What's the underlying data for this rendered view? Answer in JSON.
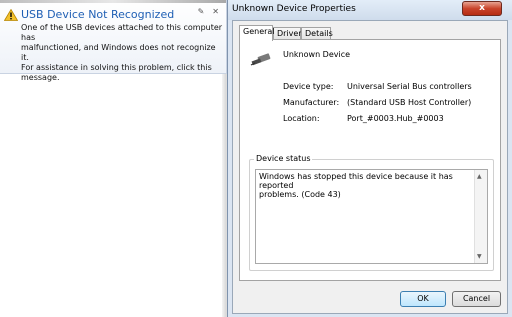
{
  "notification": {
    "title": "USB Device Not Recognized",
    "message_lines": [
      "One of the USB devices attached to this computer has",
      "malfunctioned, and Windows does not recognize it.",
      "For assistance in solving this problem, click this",
      "message."
    ],
    "warning_icon": "warning-triangle-icon",
    "pin_icon": "pin-icon",
    "close_icon": "close-icon"
  },
  "dialog": {
    "title": "Unknown Device Properties",
    "close_label": "x",
    "tabs": [
      "General",
      "Driver",
      "Details"
    ],
    "active_tab": "General",
    "device_name": "Unknown Device",
    "device_icon": "usb-plug-icon",
    "properties": [
      {
        "label": "Device type:",
        "value": "Universal Serial Bus controllers"
      },
      {
        "label": "Manufacturer:",
        "value": "(Standard USB Host Controller)"
      },
      {
        "label": "Location:",
        "value": "Port_#0003.Hub_#0003"
      }
    ],
    "status_group_label": "Device status",
    "status_lines": [
      "Windows has stopped this device because it has reported",
      "problems. (Code 43)"
    ],
    "ok_label": "OK",
    "cancel_label": "Cancel"
  }
}
